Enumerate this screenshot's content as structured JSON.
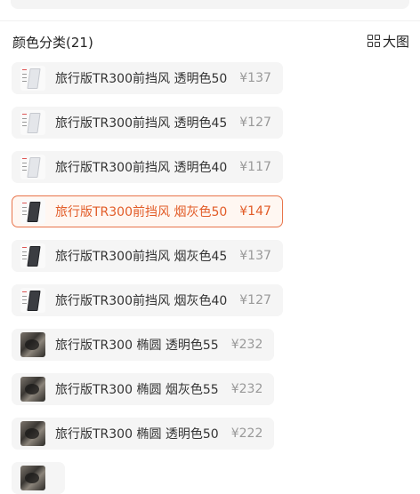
{
  "header": {
    "title": "颜色分类(21)",
    "big_view_label": "大图"
  },
  "options": [
    {
      "name": "旅行版TR300前挡风 透明色50",
      "price": "¥137",
      "thumb": "clear",
      "selected": false
    },
    {
      "name": "旅行版TR300前挡风 透明色45",
      "price": "¥127",
      "thumb": "clear",
      "selected": false
    },
    {
      "name": "旅行版TR300前挡风 透明色40",
      "price": "¥117",
      "thumb": "clear",
      "selected": false
    },
    {
      "name": "旅行版TR300前挡风 烟灰色50",
      "price": "¥147",
      "thumb": "smoke",
      "selected": true
    },
    {
      "name": "旅行版TR300前挡风 烟灰色45",
      "price": "¥137",
      "thumb": "smoke",
      "selected": false
    },
    {
      "name": "旅行版TR300前挡风 烟灰色40",
      "price": "¥127",
      "thumb": "smoke",
      "selected": false
    },
    {
      "name": "旅行版TR300 椭圆 透明色55",
      "price": "¥232",
      "thumb": "photo",
      "selected": false
    },
    {
      "name": "旅行版TR300 椭圆 烟灰色55",
      "price": "¥232",
      "thumb": "photo",
      "selected": false
    },
    {
      "name": "旅行版TR300 椭圆 透明色50",
      "price": "¥222",
      "thumb": "photo",
      "selected": false
    }
  ],
  "colors": {
    "accent": "#e25c28",
    "selected_border": "#e8744a",
    "option_bg": "#f5f5f5"
  }
}
